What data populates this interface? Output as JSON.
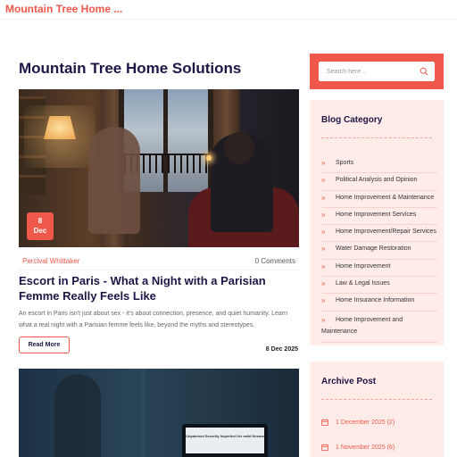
{
  "header": {
    "site_title": "Mountain Tree Home ..."
  },
  "main": {
    "page_title": "Mountain Tree Home Solutions",
    "post": {
      "date_day": "8",
      "date_month": "Dec",
      "author": "Percival Whittaker",
      "comments": "0 Comments",
      "title": "Escort in Paris - What a Night with a Parisian Femme Really Feels Like",
      "excerpt": "An escort in Paris isn't just about sex - it's about connection, presence, and quiet humanity. Learn what a real night with a Parisian femme feels like, beyond the myths and stereotypes.",
      "read_more": "Read More",
      "date": "8 Dec 2025"
    },
    "post2": {
      "screen_text": "Unpatched Security Imperfect for valid threats"
    }
  },
  "sidebar": {
    "search": {
      "placeholder": "Search here .."
    },
    "category_widget": {
      "title": "Blog Category",
      "items": [
        "Sports",
        "Political Analysis and Opinion",
        "Home Improvement & Maintenance",
        "Home Improvement Services",
        "Home Improvement/Repair Services",
        "Water Damage Restoration",
        "Home Improvement",
        "Law & Legal Issues",
        "Home Insurance Information",
        "Home Improvement and Maintenance"
      ]
    },
    "archive_widget": {
      "title": "Archive Post",
      "items": [
        "1 December 2025 (2)",
        "1 November 2025 (6)"
      ]
    }
  },
  "colors": {
    "accent": "#f0584b",
    "heading": "#1d1646",
    "widget_bg": "#ffece9"
  },
  "icons": {
    "search": "search-icon",
    "category_bullet": "double-chevron-right-icon",
    "archive": "calendar-icon"
  }
}
